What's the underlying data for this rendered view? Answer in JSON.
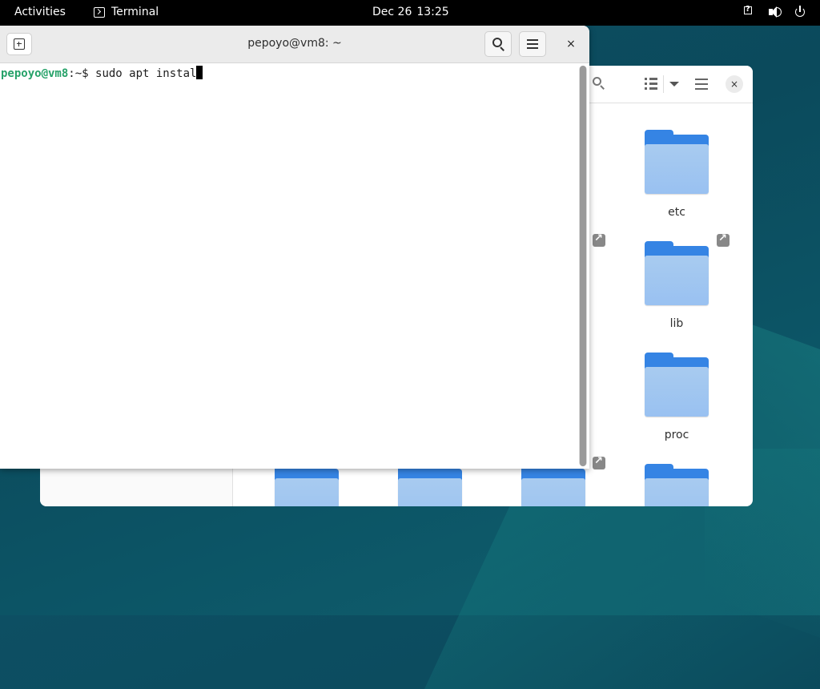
{
  "topbar": {
    "activities": "Activities",
    "app_name": "Terminal",
    "clock_date": "Dec 26",
    "clock_time": "13:25",
    "tray_icons": [
      "network-question-icon",
      "volume-icon",
      "power-icon"
    ]
  },
  "terminal": {
    "title": "pepoyo@vm8: ~",
    "close_label": "×",
    "prompt_user": "pepoyo@vm8",
    "prompt_path": ":~$",
    "command": " sudo apt instal",
    "scroll_position": 1.0
  },
  "files": {
    "folders": [
      {
        "name": "etc",
        "link": false
      },
      {
        "name": "lib",
        "link": true
      },
      {
        "name": "proc",
        "link": false
      }
    ],
    "close_label": "×"
  },
  "colors": {
    "prompt_user": "#26a269",
    "folder_blue": "#3584e4",
    "topbar": "#000000"
  }
}
